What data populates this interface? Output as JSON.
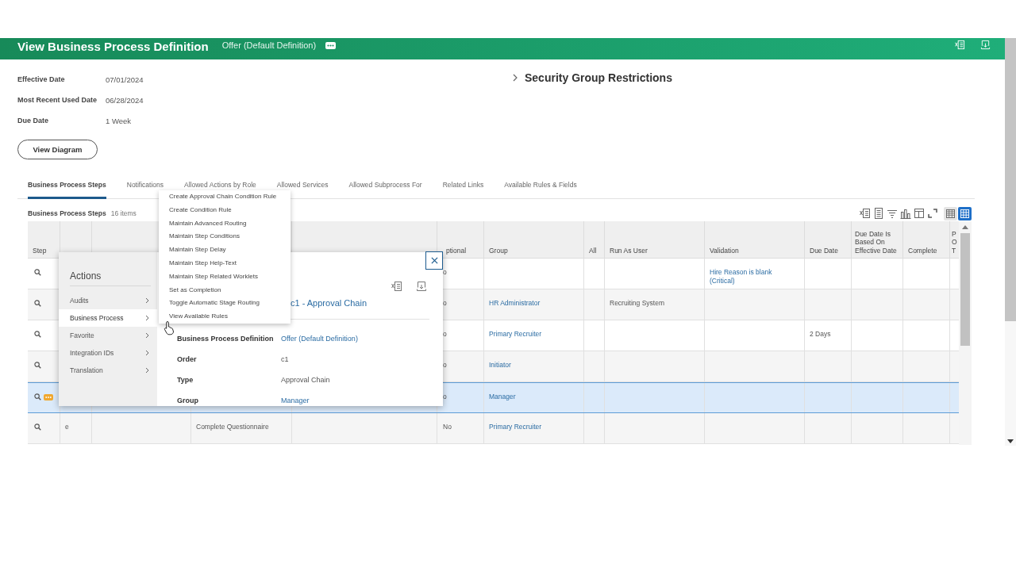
{
  "header": {
    "title": "View Business Process Definition",
    "subtitle": "Offer (Default Definition)"
  },
  "fields": [
    {
      "label": "Effective Date",
      "value": "07/01/2024"
    },
    {
      "label": "Most Recent Used Date",
      "value": "06/28/2024"
    },
    {
      "label": "Due Date",
      "value": "1 Week"
    }
  ],
  "view_diagram_button": "View Diagram",
  "security_section": {
    "title": "Security Group Restrictions",
    "expanded": false
  },
  "tabs": [
    {
      "label": "Business Process Steps",
      "selected": true
    },
    {
      "label": "Notifications",
      "selected": false
    },
    {
      "label": "Allowed Actions by Role",
      "selected": false
    },
    {
      "label": "Allowed Services",
      "selected": false
    },
    {
      "label": "Allowed Subprocess For",
      "selected": false
    },
    {
      "label": "Related Links",
      "selected": false
    },
    {
      "label": "Available Rules & Fields",
      "selected": false
    }
  ],
  "grid": {
    "title": "Business Process Steps",
    "count": "16 items",
    "view_options": [
      {
        "kind": "table",
        "selected": false
      },
      {
        "kind": "grid",
        "selected": true
      }
    ],
    "columns": [
      "Step",
      null,
      null,
      null,
      null,
      "ptional",
      "Group",
      "All",
      "Run As User",
      "Validation",
      "Due Date",
      "Due Date Is Based On Effective Date",
      "Complete",
      "P O T"
    ],
    "rows": [
      {
        "selected": false,
        "actions_badge": false,
        "cells": [
          null,
          null,
          null,
          null,
          null,
          {
            "text": "o",
            "link": false
          },
          null,
          null,
          null,
          {
            "text": "Hire Reason is blank (Critical)",
            "link": true
          },
          null,
          null,
          null,
          null
        ]
      },
      {
        "selected": false,
        "actions_badge": false,
        "cells": [
          null,
          null,
          null,
          null,
          null,
          {
            "text": "o",
            "link": false
          },
          {
            "text": "HR Administrator",
            "link": true
          },
          null,
          {
            "text": "Recruiting System",
            "link": false
          },
          null,
          null,
          null,
          null,
          null
        ]
      },
      {
        "selected": false,
        "actions_badge": false,
        "cells": [
          null,
          null,
          null,
          null,
          null,
          {
            "text": "o",
            "link": false
          },
          {
            "text": "Primary Recruiter",
            "link": true
          },
          null,
          null,
          null,
          {
            "text": "2 Days",
            "link": false
          },
          null,
          null,
          null
        ]
      },
      {
        "selected": false,
        "actions_badge": false,
        "cells": [
          null,
          null,
          null,
          null,
          null,
          {
            "text": "o",
            "link": false
          },
          {
            "text": "Initiator",
            "link": true
          },
          null,
          null,
          null,
          null,
          null,
          null,
          null
        ]
      },
      {
        "selected": true,
        "actions_badge": true,
        "cells": [
          null,
          null,
          null,
          null,
          null,
          {
            "text": "o",
            "link": false
          },
          {
            "text": "Manager",
            "link": true
          },
          null,
          null,
          null,
          null,
          null,
          null,
          null
        ]
      },
      {
        "selected": false,
        "actions_badge": false,
        "cells": [
          null,
          {
            "text": "e",
            "link": false
          },
          null,
          {
            "text": "Complete Questionnaire",
            "link": false
          },
          null,
          {
            "text": "No",
            "link": false
          },
          {
            "text": "Primary Recruiter",
            "link": true
          },
          null,
          null,
          null,
          null,
          null,
          null,
          null
        ]
      }
    ]
  },
  "actions_menu": {
    "title": "Actions",
    "items": [
      {
        "label": "Audits",
        "selected": false
      },
      {
        "label": "Business Process",
        "selected": true
      },
      {
        "label": "Favorite",
        "selected": false
      },
      {
        "label": "Integration IDs",
        "selected": false
      },
      {
        "label": "Translation",
        "selected": false
      }
    ],
    "submenu": [
      "Create Approval Chain Condition Rule",
      "Create Condition Rule",
      "Maintain Advanced Routing",
      "Maintain Step Conditions",
      "Maintain Step Delay",
      "Maintain Step Help-Text",
      "Maintain Step Related Worklets",
      "Set as Completion",
      "Toggle Automatic Stage Routing",
      "View Available Rules"
    ]
  },
  "detail_card": {
    "title": "c1 - Approval Chain",
    "fields": [
      {
        "label": "Business Process Definition",
        "value": "Offer (Default Definition)",
        "link": true
      },
      {
        "label": "Order",
        "value": "c1",
        "link": false
      },
      {
        "label": "Type",
        "value": "Approval Chain",
        "link": false
      },
      {
        "label": "Group",
        "value": "Manager",
        "link": true
      }
    ]
  }
}
